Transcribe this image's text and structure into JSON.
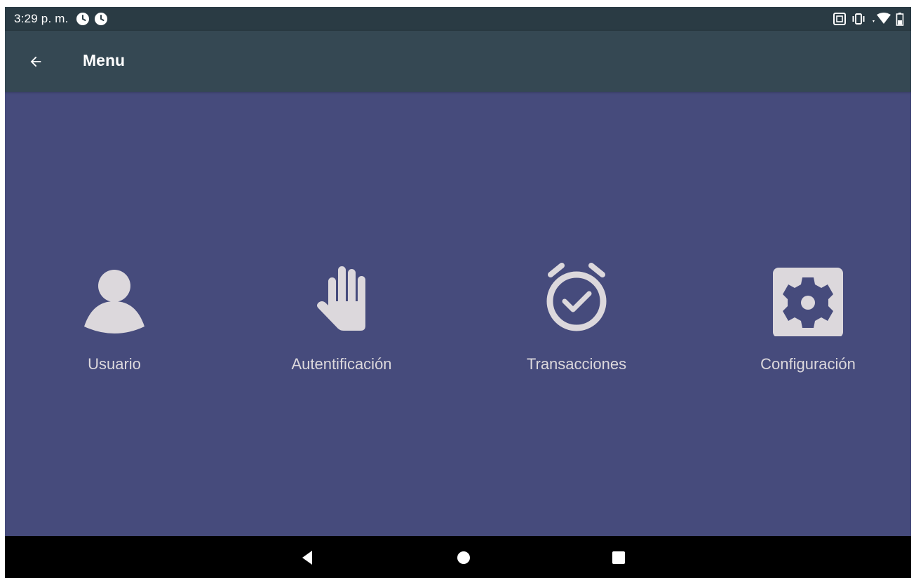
{
  "status_bar": {
    "time": "3:29 p. m.",
    "left_icons": [
      "clock-icon",
      "clock-icon"
    ],
    "right_icons": [
      "nfc-icon",
      "vibrate-icon",
      "wifi-icon",
      "battery-icon"
    ]
  },
  "app_bar": {
    "back_icon": "arrow-back-icon",
    "title": "Menu"
  },
  "menu": {
    "items": [
      {
        "label": "Usuario",
        "icon": "person-icon"
      },
      {
        "label": "Autentificación",
        "icon": "hand-icon"
      },
      {
        "label": "Transacciones",
        "icon": "alarm-check-icon"
      },
      {
        "label": "Configuración",
        "icon": "settings-icon"
      }
    ]
  },
  "nav_bar": {
    "buttons": [
      "back-triangle-icon",
      "home-circle-icon",
      "recents-square-icon"
    ]
  },
  "colors": {
    "status_bar": "#2a3b44",
    "app_bar": "#354853",
    "background": "#464b7c",
    "icon_and_label": "#dcd8dc",
    "nav_bar": "#000000"
  }
}
